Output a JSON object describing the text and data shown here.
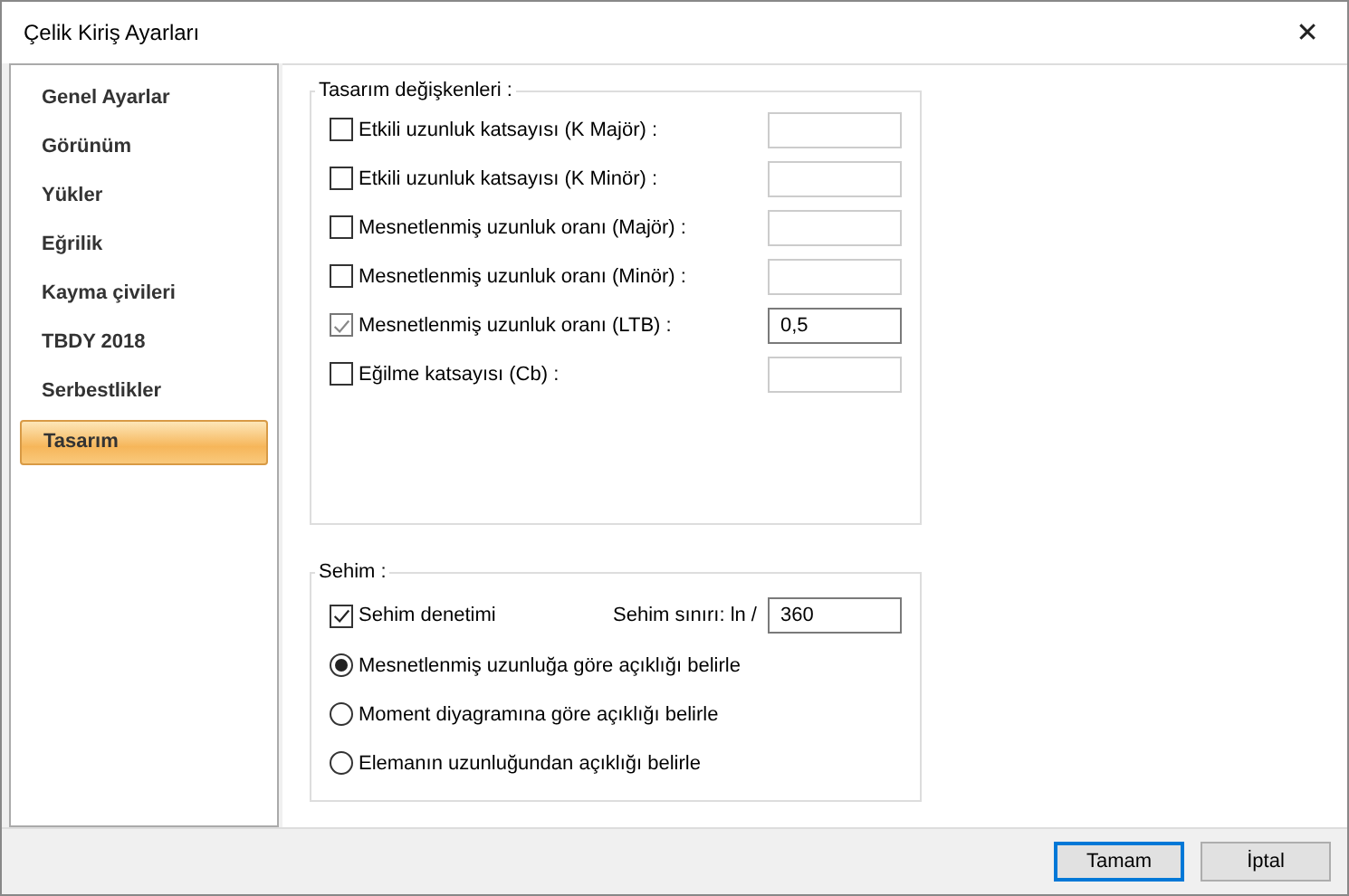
{
  "window": {
    "title": "Çelik Kiriş Ayarları",
    "close": "✕"
  },
  "sidebar": {
    "items": [
      {
        "label": "Genel Ayarlar",
        "selected": false
      },
      {
        "label": "Görünüm",
        "selected": false
      },
      {
        "label": "Yükler",
        "selected": false
      },
      {
        "label": "Eğrilik",
        "selected": false
      },
      {
        "label": "Kayma çivileri",
        "selected": false
      },
      {
        "label": "TBDY 2018",
        "selected": false
      },
      {
        "label": "Serbestlikler",
        "selected": false
      },
      {
        "label": "Tasarım",
        "selected": true
      }
    ]
  },
  "design_group": {
    "title": "Tasarım değişkenleri :",
    "rows": [
      {
        "label": "Etkili uzunluk katsayısı (K Majör) :",
        "checked": false,
        "value": ""
      },
      {
        "label": "Etkili uzunluk katsayısı (K Minör) :",
        "checked": false,
        "value": ""
      },
      {
        "label": "Mesnetlenmiş uzunluk oranı (Majör) :",
        "checked": false,
        "value": ""
      },
      {
        "label": "Mesnetlenmiş uzunluk oranı (Minör) :",
        "checked": false,
        "value": ""
      },
      {
        "label": "Mesnetlenmiş uzunluk oranı (LTB) :",
        "checked": true,
        "value": "0,5"
      },
      {
        "label": "Eğilme katsayısı (Cb) :",
        "checked": false,
        "value": ""
      }
    ]
  },
  "deflection_group": {
    "title": "Sehim :",
    "check": {
      "label": "Sehim denetimi",
      "checked": true
    },
    "limit_label": "Sehim sınırı: ln /",
    "limit_value": "360",
    "options": [
      {
        "label": "Mesnetlenmiş uzunluğa göre açıklığı belirle",
        "selected": true
      },
      {
        "label": "Moment diyagramına göre açıklığı belirle",
        "selected": false
      },
      {
        "label": "Elemanın uzunluğundan açıklığı belirle",
        "selected": false
      }
    ]
  },
  "buttons": [
    {
      "label": "Tamam",
      "default": true
    },
    {
      "label": "İptal",
      "default": false
    }
  ]
}
